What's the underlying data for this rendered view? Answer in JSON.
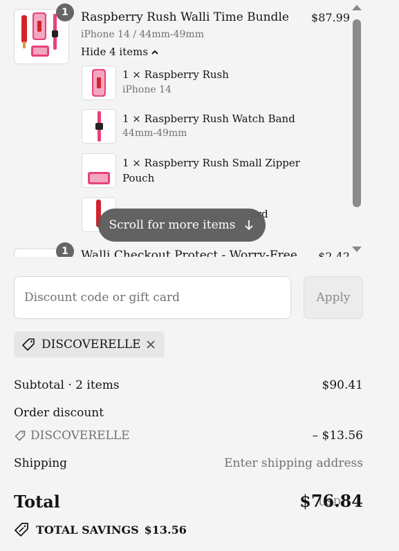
{
  "line_items": [
    {
      "title": "Raspberry Rush Walli Time Bundle",
      "variant": "iPhone 14 / 44mm-49mm",
      "price": "$87.99",
      "quantity": "1",
      "toggle_label": "Hide 4 items",
      "bundle_items": [
        {
          "title": "1 × Raspberry Rush",
          "variant": "iPhone 14"
        },
        {
          "title": "1 × Raspberry Rush Watch Band",
          "variant": "44mm-49mm"
        },
        {
          "title": "1 × Raspberry Rush Small Zipper Pouch",
          "variant": ""
        },
        {
          "title": "ard",
          "variant": ""
        }
      ]
    },
    {
      "title": "Walli Checkout Protect - Worry-Free",
      "price": "$2.42",
      "quantity": "1"
    }
  ],
  "scroll_hint": "Scroll for more items",
  "discount": {
    "placeholder": "Discount code or gift card",
    "apply_label": "Apply",
    "applied_code": "DISCOVERELLE"
  },
  "summary": {
    "subtotal_label": "Subtotal · 2 items",
    "subtotal_value": "$90.41",
    "order_discount_label": "Order discount",
    "discount_code": "DISCOVERELLE",
    "discount_value": "– $13.56",
    "shipping_label": "Shipping",
    "shipping_value": "Enter shipping address",
    "total_label": "Total",
    "currency": "USD",
    "total_value": "$76.84",
    "savings_label": "TOTAL SAVINGS",
    "savings_value": "$13.56"
  },
  "colors": {
    "accent_pink": "#e8417a",
    "accent_red": "#d2222c",
    "background": "#f4f4f4"
  }
}
